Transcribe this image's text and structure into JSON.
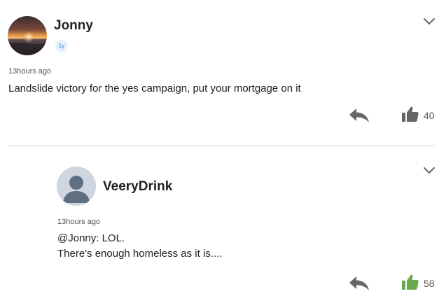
{
  "comments": [
    {
      "username": "Jonny",
      "badge": "1y",
      "time": "13hours ago",
      "lines": [
        "Landslide victory for the yes campaign, put your mortgage on it"
      ],
      "likes": "40",
      "liked": false,
      "avatar": "sunset-photo"
    },
    {
      "username": "VeeryDrink",
      "time": "13hours ago",
      "lines": [
        "@Jonny: LOL.",
        "There's enough homeless as it is...."
      ],
      "likes": "58",
      "liked": true,
      "avatar": "default-user-silhouette"
    }
  ],
  "colors": {
    "like_default": "#666666",
    "like_active": "#6aa84f",
    "reply_icon": "#666666",
    "divider": "#d8d8d8",
    "badge_text": "#3b78c4"
  },
  "icons": [
    "chevron-down-icon",
    "reply-arrow-icon",
    "thumbs-up-icon"
  ]
}
